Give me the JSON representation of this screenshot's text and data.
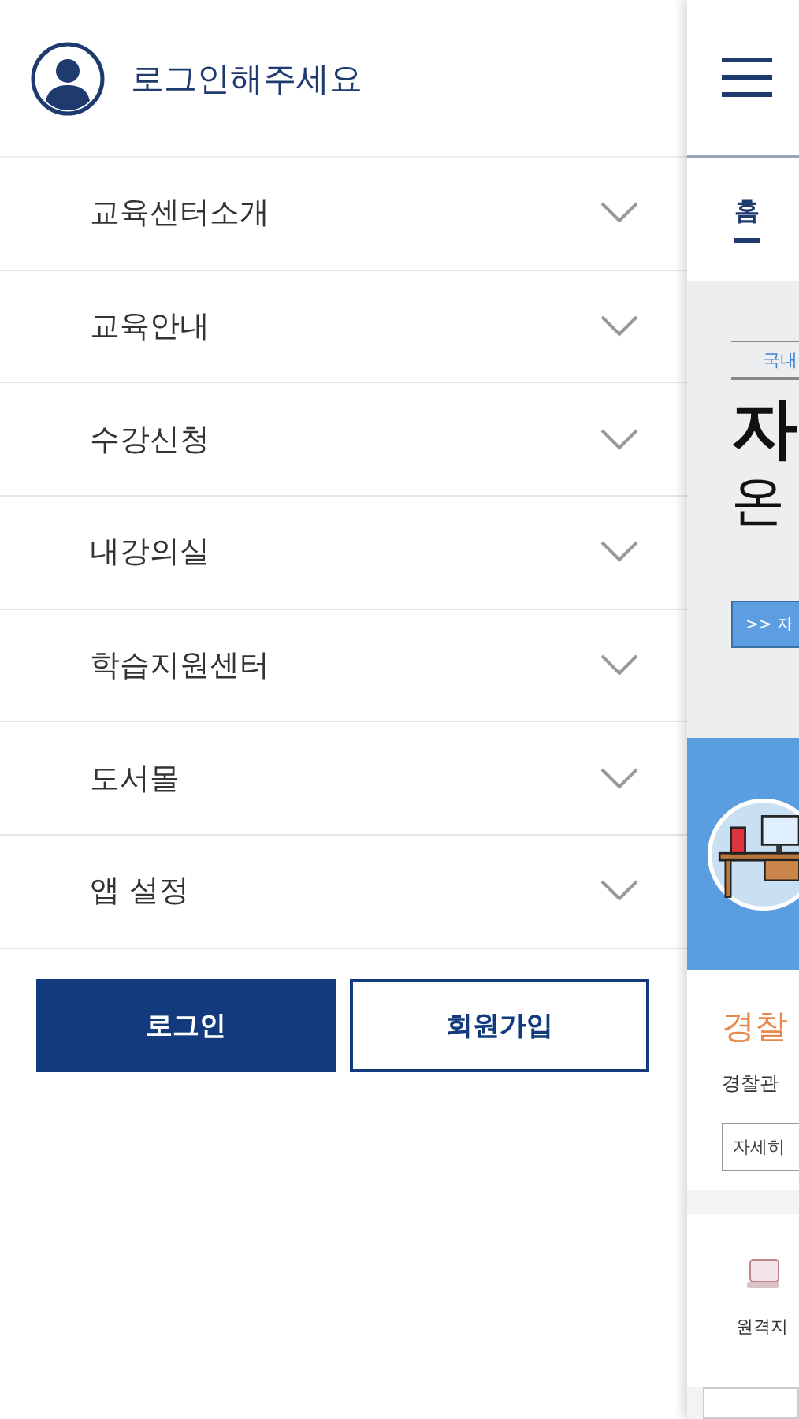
{
  "drawer": {
    "login_prompt": "로그인해주세요",
    "menu": [
      {
        "label": "교육센터소개",
        "expanded": false
      },
      {
        "label": "교육안내",
        "expanded": false
      },
      {
        "label": "수강신청",
        "expanded": false
      },
      {
        "label": "내강의실",
        "expanded": false
      },
      {
        "label": "학습지원센터",
        "expanded": false
      },
      {
        "label": "도서몰",
        "expanded": false
      },
      {
        "label": "앱 설정",
        "expanded": false
      }
    ],
    "buttons": [
      {
        "label": "로그인",
        "kind": "primary"
      },
      {
        "label": "회원가입",
        "kind": "outline"
      }
    ]
  },
  "background_page": {
    "tabs": [
      {
        "label": "홈",
        "selected": true
      }
    ],
    "banner": {
      "tag": "국내",
      "title_line_1": "자",
      "title_line_2": "온",
      "button": ">> 자"
    },
    "card": {
      "title": "경찰",
      "text": "경찰관",
      "button": "자세히"
    },
    "quick_link": {
      "label": "원격지"
    }
  }
}
